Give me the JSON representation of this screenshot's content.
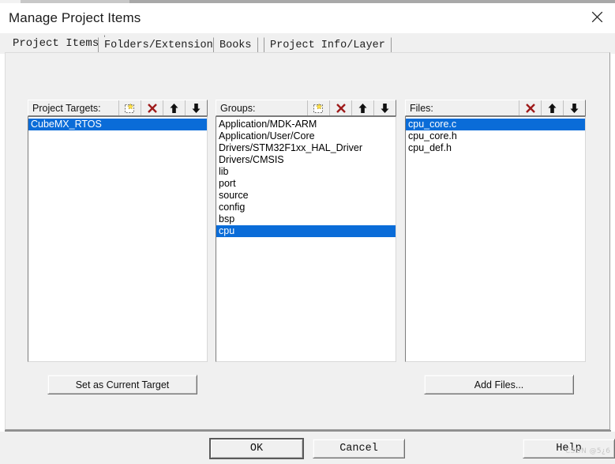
{
  "window": {
    "title": "Manage Project Items",
    "close_icon": "close-icon"
  },
  "tabs": [
    {
      "label": "Project Items",
      "active": true
    },
    {
      "label": "Folders/Extensions",
      "active": false
    },
    {
      "label": "Books",
      "active": false
    },
    {
      "label": "Project Info/Layer",
      "active": false
    }
  ],
  "panels": {
    "targets": {
      "header": "Project Targets:",
      "tools": [
        "new-item-icon",
        "delete-icon",
        "move-up-icon",
        "move-down-icon"
      ],
      "items": [
        {
          "label": "CubeMX_RTOS",
          "selected": true
        }
      ],
      "action_button": "Set as Current Target"
    },
    "groups": {
      "header": "Groups:",
      "tools": [
        "new-item-icon",
        "delete-icon",
        "move-up-icon",
        "move-down-icon"
      ],
      "items": [
        {
          "label": "Application/MDK-ARM",
          "selected": false
        },
        {
          "label": "Application/User/Core",
          "selected": false
        },
        {
          "label": "Drivers/STM32F1xx_HAL_Driver",
          "selected": false
        },
        {
          "label": "Drivers/CMSIS",
          "selected": false
        },
        {
          "label": "lib",
          "selected": false
        },
        {
          "label": "port",
          "selected": false
        },
        {
          "label": "source",
          "selected": false
        },
        {
          "label": "config",
          "selected": false
        },
        {
          "label": "bsp",
          "selected": false
        },
        {
          "label": "cpu",
          "selected": true
        }
      ]
    },
    "files": {
      "header": "Files:",
      "tools": [
        "delete-icon",
        "move-up-icon",
        "move-down-icon"
      ],
      "items": [
        {
          "label": "cpu_core.c",
          "selected": true
        },
        {
          "label": "cpu_core.h",
          "selected": false
        },
        {
          "label": "cpu_def.h",
          "selected": false
        }
      ],
      "action_button": "Add Files..."
    }
  },
  "footer": {
    "ok_label": "OK",
    "cancel_label": "Cancel",
    "help_label": "Help"
  },
  "watermark": "CSDN @5¿6",
  "colors": {
    "selection_blue": "#0a6cd8",
    "selection_text": "#ffffff",
    "dialog_face": "#f0f0f0",
    "delete_icon_red": "#9e1b1b",
    "list_background": "#ffffff"
  }
}
